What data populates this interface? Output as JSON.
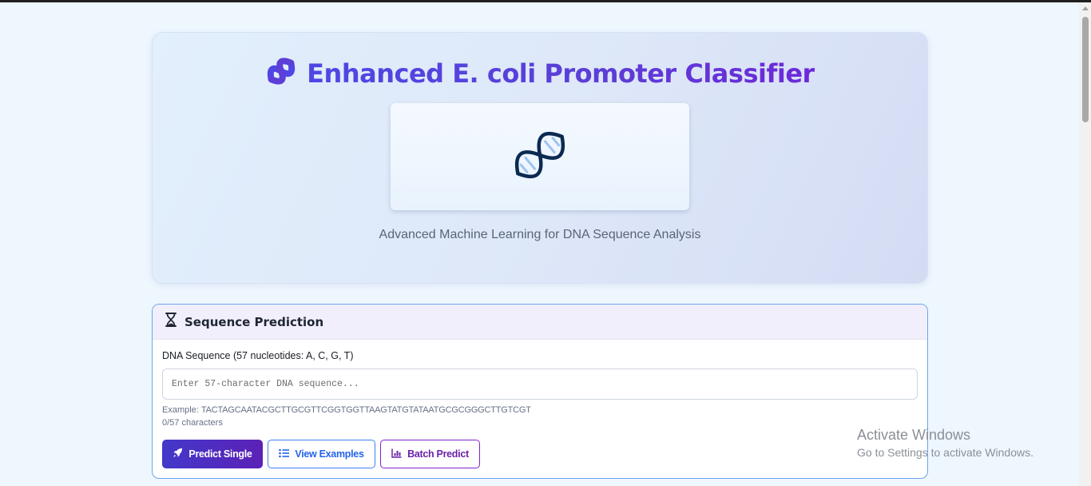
{
  "hero": {
    "title": "Enhanced E. coli Promoter Classifier",
    "title_icon": "dna-icon",
    "image_icon": "dna-double-helix-icon",
    "subtitle": "Advanced Machine Learning for DNA Sequence Analysis"
  },
  "prediction": {
    "header_icon": "hourglass-icon",
    "title": "Sequence Prediction",
    "field_label": "DNA Sequence (57 nucleotides: A, C, G, T)",
    "input_placeholder": "Enter 57-character DNA sequence...",
    "input_value": "",
    "example_label": "Example:",
    "example_sequence": "TACTAGCAATACGCTTGCGTTCGGTGGTTAAGTATGTATAATGCGCGGGCTTGTCGT",
    "char_count": "0/57 characters",
    "buttons": {
      "predict_single": "Predict Single",
      "view_examples": "View Examples",
      "batch_predict": "Batch Predict"
    },
    "button_icons": [
      "rocket-icon",
      "list-icon",
      "bar-chart-icon"
    ]
  },
  "watermark": {
    "line1": "Activate Windows",
    "line2": "Go to Settings to activate Windows."
  },
  "colors": {
    "accent_indigo": "#4f46e5",
    "accent_purple": "#6d28d9",
    "outline_blue": "#3b82f6",
    "panel_border": "#6aa6ee",
    "page_background": "#eef6fe"
  }
}
